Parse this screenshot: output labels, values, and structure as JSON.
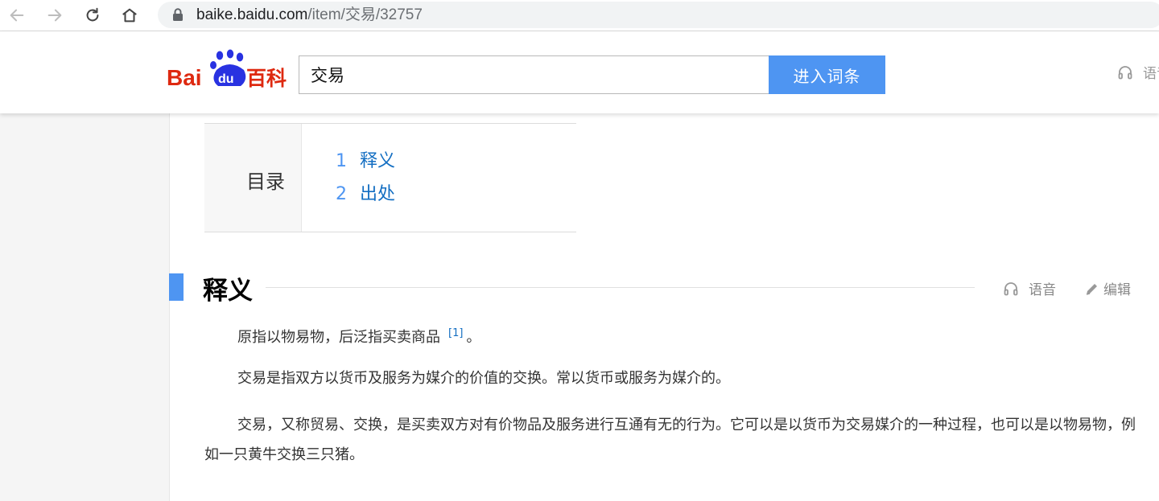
{
  "browser": {
    "url_host": "baike.baidu.com",
    "url_path": "/item/交易/32757"
  },
  "header": {
    "logo_alt": "Baidu百科",
    "search_value": "交易",
    "search_button_label": "进入词条",
    "voice_label": "语音"
  },
  "toc": {
    "title": "目录",
    "items": [
      {
        "num": "1",
        "label": "释义"
      },
      {
        "num": "2",
        "label": "出处"
      }
    ]
  },
  "section": {
    "title": "释义",
    "voice_label": "语音",
    "edit_label": "编辑"
  },
  "content": {
    "para1_text": "原指以物易物，后泛指买卖商品",
    "para1_ref": "[1]",
    "para1_end": "。",
    "para2": "交易是指双方以货币及服务为媒介的价值的交换。常以货币或服务为媒介的。",
    "para3": "交易，又称贸易、交换，是买卖双方对有价物品及服务进行互通有无的行为。它可以是以货币为交易媒介的一种过程，也可以是以物易物，例如一只黄牛交换三只猪。"
  },
  "colors": {
    "accent_blue": "#4e95f2",
    "link_blue": "#136ec2",
    "logo_red": "#de2910",
    "logo_blue": "#2932e1"
  },
  "icons": [
    "back-arrow-icon",
    "forward-arrow-icon",
    "reload-icon",
    "home-icon",
    "lock-icon",
    "headphones-icon",
    "pencil-icon"
  ]
}
